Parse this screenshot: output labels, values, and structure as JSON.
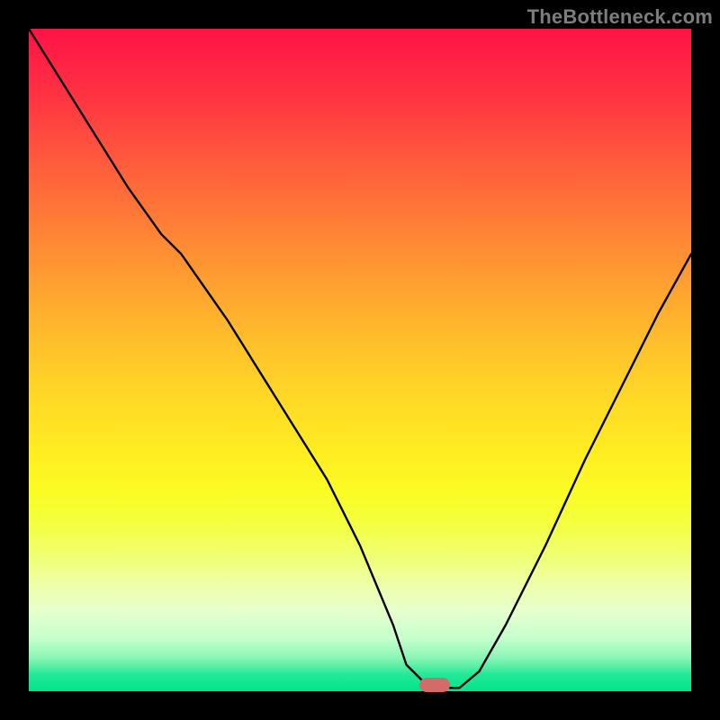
{
  "watermark": "TheBottleneck.com",
  "marker": {
    "x_pct": 61.3,
    "y_pct": 99.0
  },
  "chart_data": {
    "type": "line",
    "title": "",
    "xlabel": "",
    "ylabel": "",
    "xlim": [
      0,
      100
    ],
    "ylim": [
      0,
      100
    ],
    "background_gradient": {
      "top": "#ff1346",
      "bottom": "#00e48c",
      "note": "vertical rainbow gradient red→orange→yellow→green"
    },
    "series": [
      {
        "name": "bottleneck-curve",
        "x": [
          0,
          5,
          10,
          15,
          20,
          23,
          30,
          35,
          40,
          45,
          50,
          55,
          57,
          60,
          63,
          65,
          68,
          72,
          78,
          84,
          90,
          95,
          100
        ],
        "values": [
          100,
          92,
          84,
          76,
          69,
          66,
          56,
          48,
          40,
          32,
          22,
          10,
          4,
          1,
          0.5,
          0.5,
          3,
          10,
          22,
          35,
          47,
          57,
          66
        ]
      }
    ],
    "marker_point": {
      "x": 61.3,
      "y": 0.8,
      "color": "#d46a6a"
    }
  }
}
